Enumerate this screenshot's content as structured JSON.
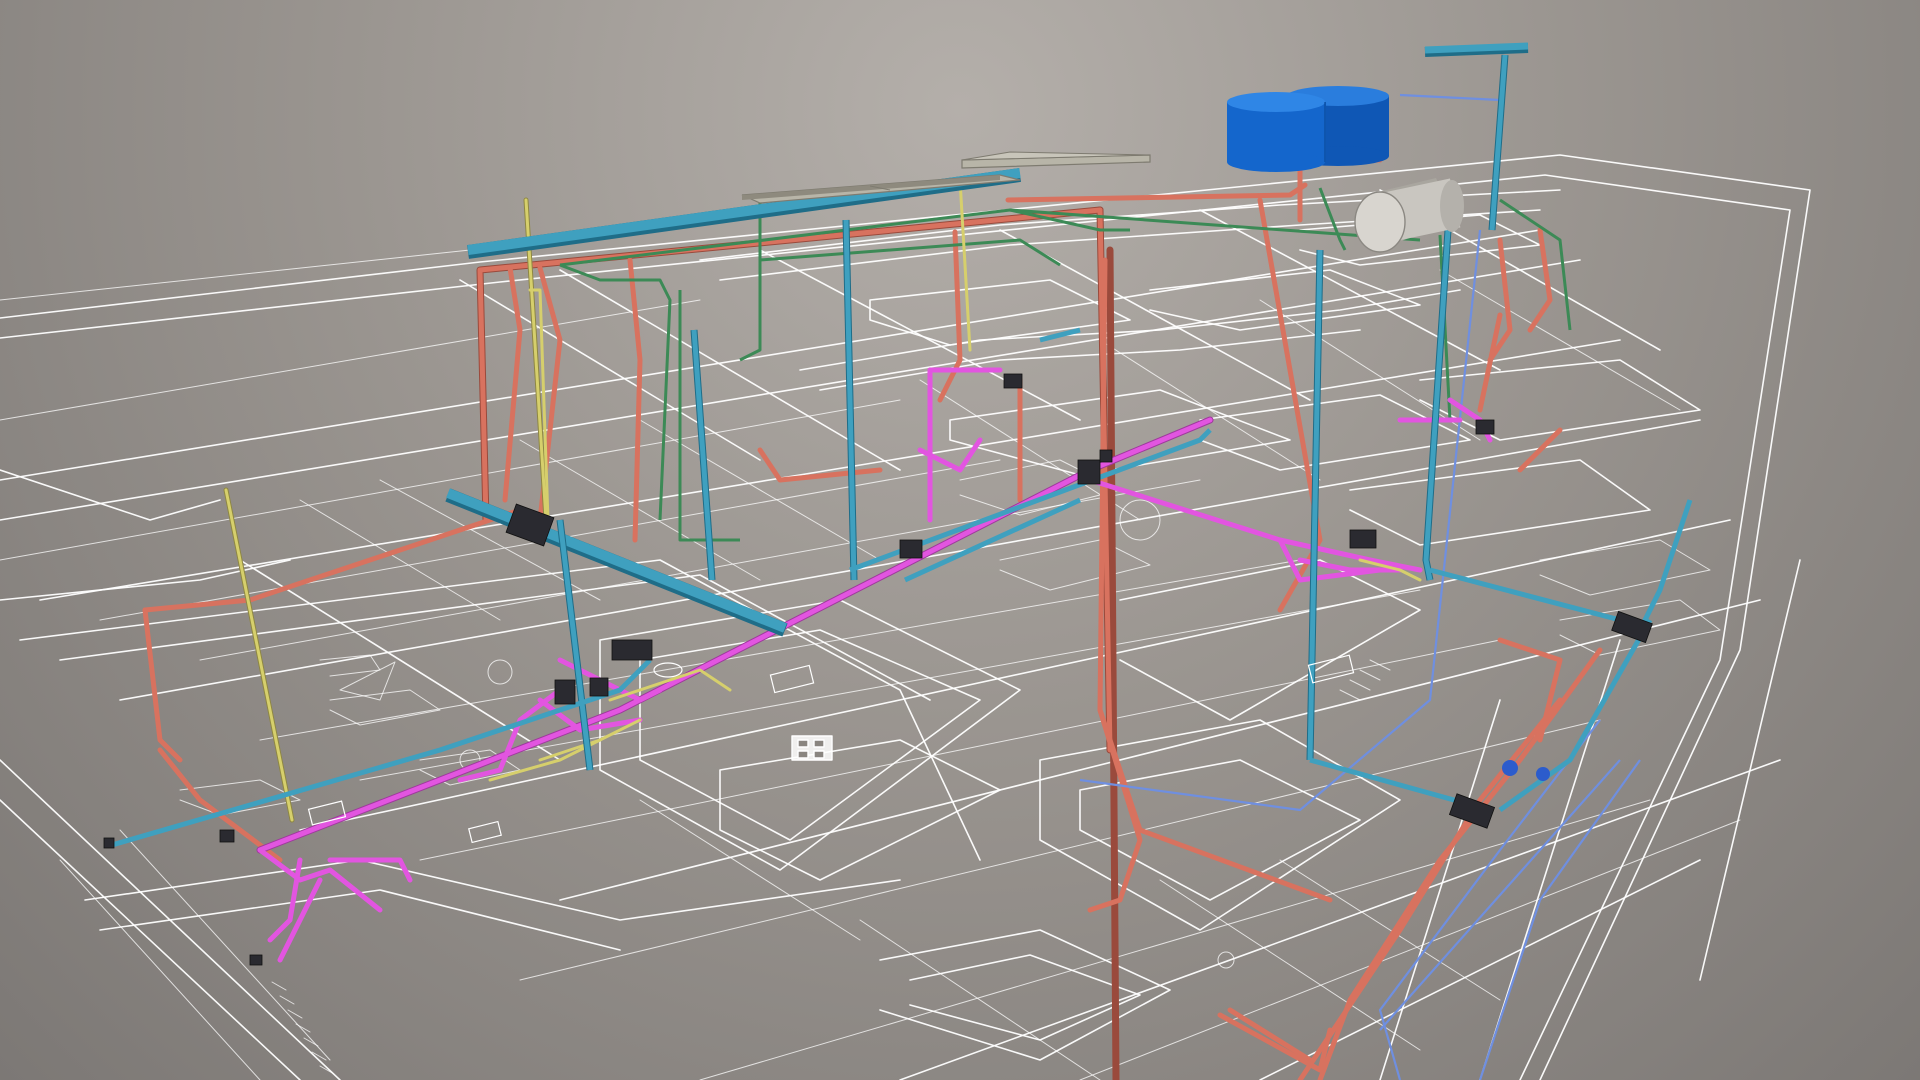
{
  "scene": {
    "background": "#9a9590",
    "colors": {
      "floor_plan_lines": "#ffffff",
      "drain_pipe": "#3fa0bf",
      "drain_pipe_dark": "#1f6d88",
      "hot_water_pipe": "#d8725f",
      "hot_water_pipe_dark": "#9a4a3c",
      "cold_water_pipe": "#e255e0",
      "vent_pipe": "#d6cf6c",
      "gas_pipe": "#3c8a56",
      "supply_line_blue": "#6f8fe0",
      "water_tank": "#1466cc",
      "water_heater": "#c9c6c0",
      "solar_panel": "#b8b5a8",
      "fixture": "#2a2a30"
    },
    "elements": [
      {
        "name": "floor-plan-outline",
        "icon": "floor-plan"
      },
      {
        "name": "water-storage-tank",
        "icon": "tank"
      },
      {
        "name": "water-heater-cylinder",
        "icon": "cylinder"
      },
      {
        "name": "solar-collector-panel",
        "icon": "panel"
      },
      {
        "name": "vent-stack",
        "icon": "vent"
      },
      {
        "name": "main-drain-pipe",
        "icon": "pipe"
      }
    ]
  }
}
